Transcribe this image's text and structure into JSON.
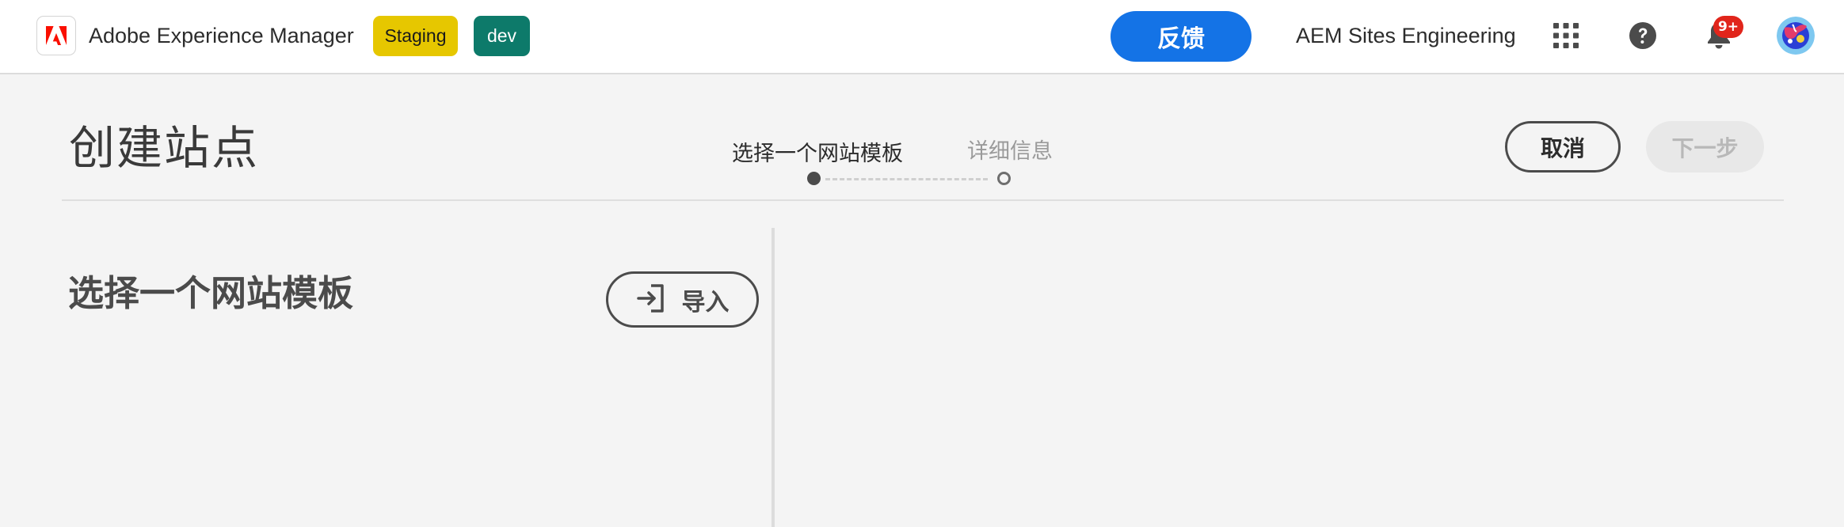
{
  "header": {
    "app_title": "Adobe Experience Manager",
    "badges": {
      "staging": "Staging",
      "dev": "dev"
    },
    "feedback_label": "反馈",
    "org_name": "AEM Sites Engineering",
    "notification_count": "9+",
    "icons": [
      "adobe-logo-icon",
      "apps-grid-icon",
      "help-icon",
      "bell-icon",
      "avatar"
    ]
  },
  "wizard": {
    "title": "创建站点",
    "steps": [
      {
        "label": "选择一个网站模板",
        "state": "active"
      },
      {
        "label": "详细信息",
        "state": "upcoming"
      }
    ],
    "cancel_label": "取消",
    "next_label": "下一步"
  },
  "main": {
    "heading": "选择一个网站模板",
    "import_label": "导入"
  },
  "colors": {
    "accent": "#1473e6",
    "staging_badge": "#e6c700",
    "dev_badge": "#0d7a6a",
    "notification": "#e1251b",
    "adobe_red": "#fa0f00"
  }
}
